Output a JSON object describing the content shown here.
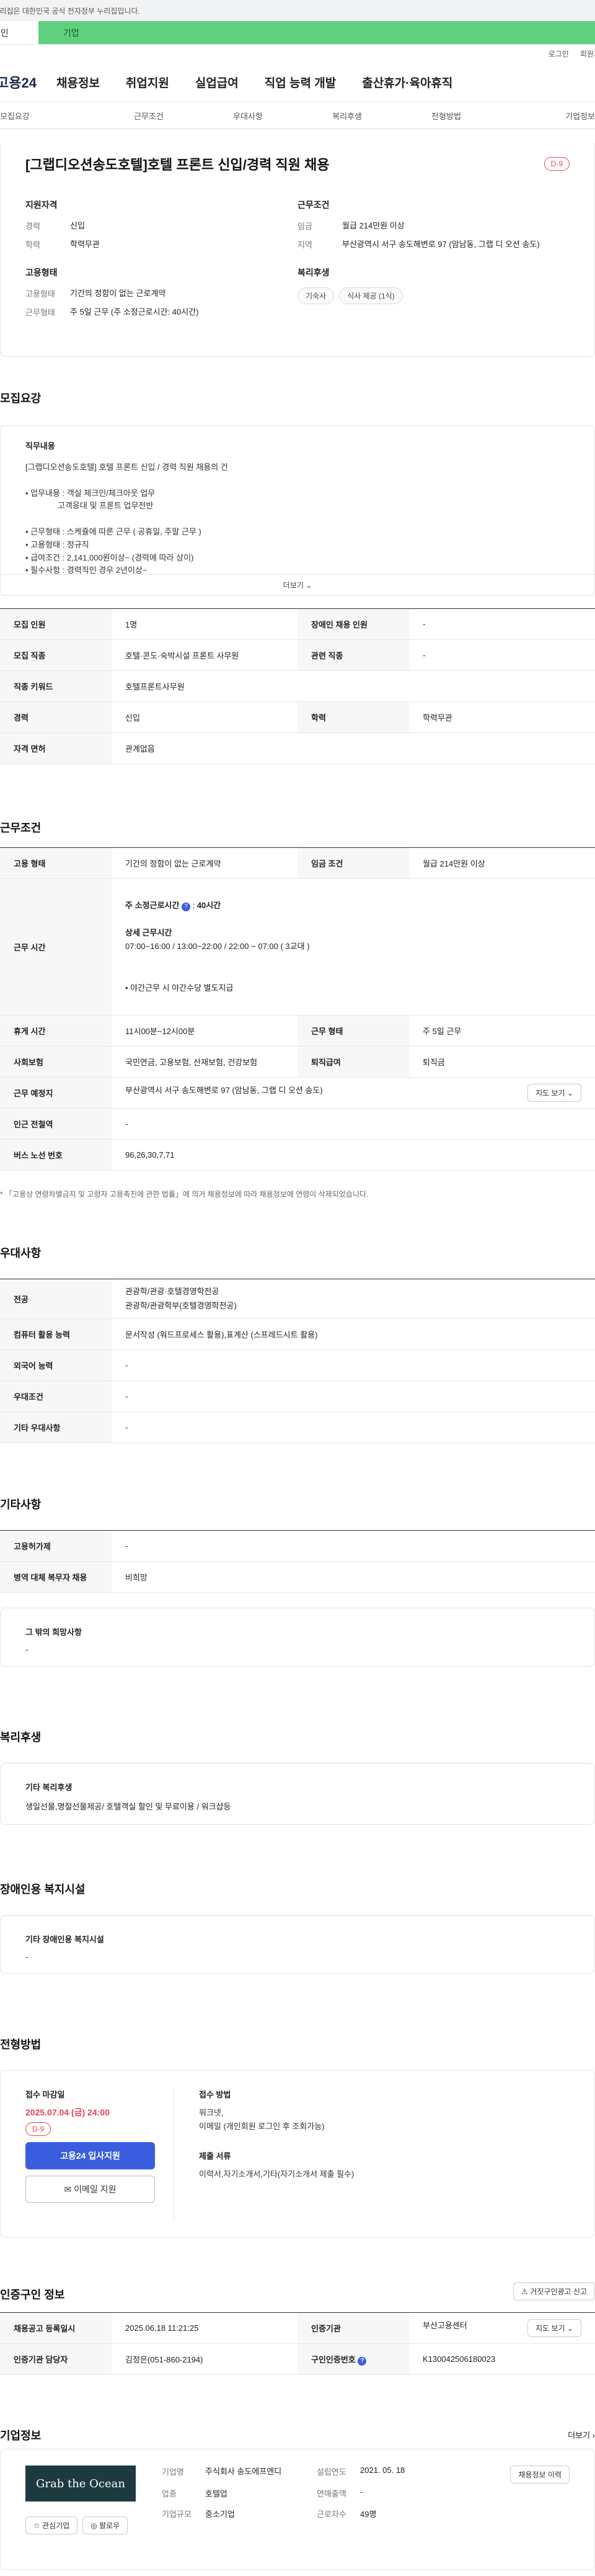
{
  "gov_banner": "이 누리집은 대한민국 공식 전자정부 누리집입니다.",
  "top_tabs": {
    "tab1": "개인",
    "tab2": "기업"
  },
  "util": {
    "login": "로그인",
    "join": "회원가입"
  },
  "gnb": {
    "logo": "고용24",
    "items": [
      "채용정보",
      "취업지원",
      "실업급여",
      "직업 능력 개발",
      "출산휴가·육아휴직"
    ]
  },
  "subnav": [
    "모집요강",
    "근무조건",
    "우대사항",
    "복리후생",
    "전형방법",
    "기업정보"
  ],
  "job": {
    "title": "[그랩디오션송도호텔]호텔 프론트 신입/경력 직원 채용",
    "dday": "D-9",
    "qual": {
      "h": "지원자격",
      "k1": "경력",
      "v1": "신입",
      "k2": "학력",
      "v2": "학력무관"
    },
    "cond": {
      "h": "근무조건",
      "k1": "임금",
      "v1": "월급 214만원 이상",
      "k2": "지역",
      "v2": "부산광역시 서구 송도해변로 97 (암남동, 그랩 디 오션 송도)"
    },
    "emp": {
      "h": "고용형태",
      "k1": "고용형태",
      "v1": "기간의 정함이 없는 근로계약",
      "k2": "근무형태",
      "v2": "주 5일 근무 (주 소정근로시간: 40시간)"
    },
    "welfare": {
      "h": "복리후생",
      "c1": "기숙사",
      "c2": "식사 제공 (1식)"
    }
  },
  "recruit": {
    "h": "모집요강",
    "duty_h": "직무내용",
    "lines": [
      "[그랩디오션송도호텔] 호텔 프론트 신입 / 경력 직원 채용의 건",
      "• 업무내용 : 객실 체크인/체크아웃 업무",
      "고객응대 및 프론트 업무전반",
      "• 근무형태 : 스케쥴에 따른 근무 ( 공휴일, 주말 근무 )",
      "• 고용형태 : 정규직",
      "• 급여조건 : 2,141,000원이상~ (경력에 따라 상이)",
      "• 필수사항 : 경력직인 경우 2년이상~"
    ],
    "more": "더보기",
    "rows": [
      {
        "k1": "모집 인원",
        "v1": "1명",
        "k2": "장애인 채용 인원",
        "v2": "-"
      },
      {
        "k1": "모집 직종",
        "v1": "호텔·콘도·숙박시설 프론트 사무원",
        "k2": "관련 직종",
        "v2": "-"
      },
      {
        "k1": "직종 키워드",
        "v1": "호텔프론트사무원",
        "k2": "",
        "v2": ""
      },
      {
        "k1": "경력",
        "v1": "신입",
        "k2": "학력",
        "v2": "학력무관"
      },
      {
        "k1": "자격 면허",
        "v1": "관계없음",
        "k2": "",
        "v2": ""
      }
    ]
  },
  "work": {
    "h": "근무조건",
    "emp_k": "고용 형태",
    "emp_v": "기간의 정함이 없는 근로계약",
    "wage_k": "임금 조건",
    "wage_v": "월급 214만원 이상",
    "time_k": "근무 시간",
    "weekly": "주 소정근로시간",
    "weekly_v": "40시간",
    "detail_h": "상세 근무시간",
    "detail_v": "07:00~16:00 / 13:00~22:00 / 22:00 ~ 07:00 ( 3교대 )",
    "night": "• 야간근무 시 야간수당 별도지급",
    "rest_k": "휴게 시간",
    "rest_v": "11시00분~12시00분",
    "form_k": "근무 형태",
    "form_v": "주 5일 근무",
    "ins_k": "사회보험",
    "ins_v": "국민연금, 고용보험, 산재보험, 건강보험",
    "ret_k": "퇴직급여",
    "ret_v": "퇴직금",
    "place_k": "근무 예정지",
    "place_v": "부산광역시 서구 송도해변로 97 (암남동, 그랩 디 오션 송도)",
    "map_btn": "지도 보기",
    "subway_k": "인근 전철역",
    "subway_v": "-",
    "bus_k": "버스 노선 번호",
    "bus_v": "96,26,30,7,71",
    "note": "* 「고용상 연령차별금지 및 고령자 고용촉진에 관한 법률」에 의거 채용정보에 따라 채용정보에 연령이 삭제되었습니다."
  },
  "pref": {
    "h": "우대사항",
    "rows": [
      {
        "k": "전공",
        "v": "관광학/관광·호텔경영학전공\n관광학/관광학부(호텔경영학전공)"
      },
      {
        "k": "컴퓨터 활용 능력",
        "v": "문서작성 (워드프로세스 활용),표계산 (스프레드시트 활용)"
      },
      {
        "k": "외국어 능력",
        "v": "-"
      },
      {
        "k": "우대조건",
        "v": "-"
      },
      {
        "k": "기타 우대사항",
        "v": "-"
      }
    ]
  },
  "etc": {
    "h": "기타사항",
    "rows": [
      {
        "k": "고용허가제",
        "v": "-"
      },
      {
        "k": "병역 대체 복무자 채용",
        "v": "비희망"
      }
    ],
    "hope_h": "그 밖의 희망사항",
    "hope_v": "-"
  },
  "welfare2": {
    "h": "복리후생",
    "sub": "기타 복리후생",
    "v": "생일선물,명절선물제공/ 호텔객실 할인 및 무료이용 / 워크샵등"
  },
  "disab": {
    "h": "장애인용 복지시설",
    "sub": "기타 장애인용 복지시설",
    "v": "-"
  },
  "select": {
    "h": "전형방법",
    "deadline_h": "접수 마감일",
    "deadline_v": "2025.07.04 (금) 24:00",
    "dday": "D-9",
    "apply": "고용24 입사지원",
    "email": "이메일 지원",
    "method_h": "접수 방법",
    "method_v": "워크넷,\n이메일 (개인회원 로그인 후 조회가능)",
    "docs_h": "제출 서류",
    "docs_v": "이력서,자기소개서,기타(자기소개서 제출 필수)"
  },
  "cert": {
    "h": "인증구인 정보",
    "report": "거짓구인광고 신고",
    "rows": [
      {
        "k1": "채용공고 등록일시",
        "v1": "2025.06.18 11:21:25",
        "k2": "인증기관",
        "v2": "부산고용센터",
        "btn": "지도 보기"
      },
      {
        "k1": "인증기관 담당자",
        "v1": "김정은(051-860-2194)",
        "k2": "구인인증번호",
        "v2": "K130042506180023",
        "btn": ""
      }
    ]
  },
  "company": {
    "h": "기업정보",
    "more": "더보기",
    "logo": "Grab the Ocean",
    "fav": "관심기업",
    "follow": "팔로우",
    "k1": "기업명",
    "v1": "주식회사 송도에프엔디",
    "k2": "업종",
    "v2": "호텔업",
    "k3": "기업규모",
    "v3": "중소기업",
    "k4": "설립연도",
    "v4": "2021. 05. 18",
    "k5": "연매출액",
    "v5": "-",
    "k6": "근로자수",
    "v6": "49명",
    "btn": "채용정보 이력"
  }
}
